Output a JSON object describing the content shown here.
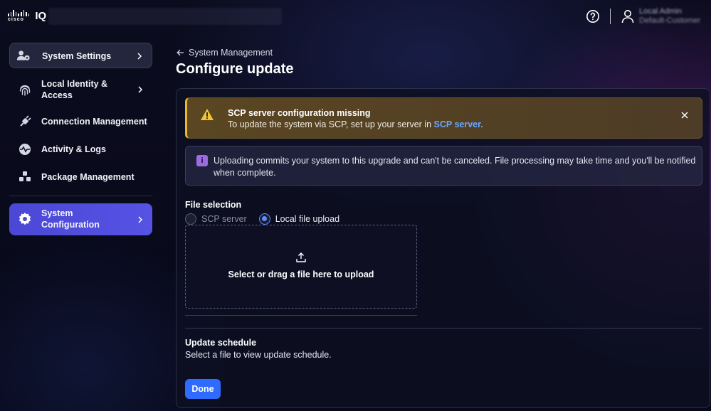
{
  "header": {
    "brand": "cisco",
    "product": "IQ",
    "user_name": "Local Admin",
    "user_org": "Default-Customer",
    "icons": [
      "help-icon",
      "user-icon"
    ]
  },
  "sidebar": {
    "items": [
      {
        "label": "System Settings",
        "icon": "user-settings-icon"
      },
      {
        "label": "Local Identity & Access",
        "icon": "fingerprint-icon"
      },
      {
        "label": "Connection Management",
        "icon": "plug-icon"
      },
      {
        "label": "Activity & Logs",
        "icon": "pulse-icon"
      },
      {
        "label": "Package Management",
        "icon": "packages-icon"
      },
      {
        "label": "System Configuration",
        "icon": "gear-icon"
      }
    ]
  },
  "main": {
    "back_label": "System Management",
    "title": "Configure update",
    "warning": {
      "title": "SCP server configuration missing",
      "text": "To update the system via SCP, set up your server in",
      "link": "SCP server."
    },
    "info": {
      "text": "Uploading commits your system to this upgrade and can't be canceled. File processing may take time and you'll be notified when complete."
    },
    "file_selection": {
      "label": "File selection",
      "options": [
        "SCP server",
        "Local file upload"
      ],
      "selected": "Local file upload",
      "dropzone_text": "Select or drag a file here to upload"
    },
    "schedule": {
      "label": "Update schedule",
      "text": "Select a file to view update schedule."
    },
    "done_label": "Done"
  },
  "colors": {
    "accent": "#2f6bff",
    "active_nav": "#4b48d6",
    "warning": "#e8b92c",
    "info": "#9b6be0"
  }
}
